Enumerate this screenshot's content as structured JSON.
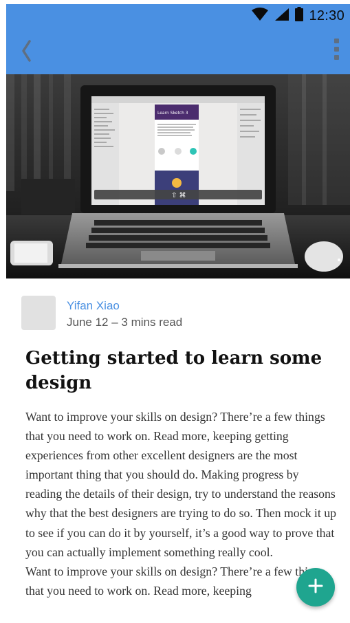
{
  "status_bar": {
    "time": "12:30",
    "icons": [
      "wifi-icon",
      "cellular-signal-icon",
      "battery-icon"
    ]
  },
  "app_bar": {
    "color": "#4a90e2",
    "back_icon": "chevron-left-icon",
    "menu_icon": "more-vertical-icon"
  },
  "hero": {
    "image": "photo of a laptop on a desk showing a design app with a 'Learn Sketch 3' page",
    "screen_heading": "Learn Sketch 3",
    "shortcut_overlay": "⇧ ⌘"
  },
  "post": {
    "author": "Yifan Xiao",
    "meta": "June 12 – 3 mins read",
    "title": "Getting started to learn some design",
    "body": [
      "Want to improve your skills on design? There’re a few things that you need to work on. Read more, keeping getting experiences from other excellent designers are the most important thing that you should do. Making progress by reading the details of their design, try to understand the reasons why that the best designers are trying to do so. Then mock it up to see if you can do it by yourself, it’s a good way to prove that you can actually implement something really cool.",
      "Want to improve your skills on design? There’re a few things that you need to work on. Read more, keeping"
    ]
  },
  "fab": {
    "icon": "plus-icon",
    "color": "#1fa58f"
  }
}
